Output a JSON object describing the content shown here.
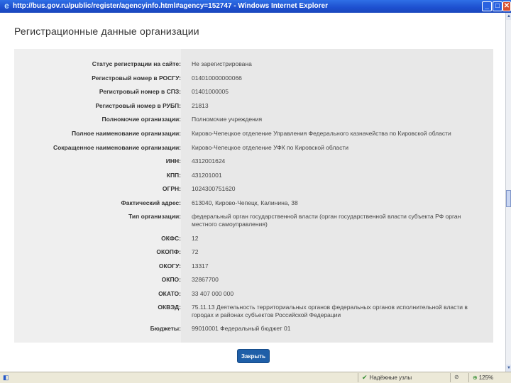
{
  "window": {
    "title": "http://bus.gov.ru/public/register/agencyinfo.html#agency=152747 - Windows Internet Explorer",
    "minimize": "_",
    "maximize": "□",
    "close": "✕"
  },
  "dialog": {
    "title": "Регистрационные данные организации",
    "fields": [
      {
        "label": "Статус регистрации на сайте:",
        "value": "Не зарегистрирована"
      },
      {
        "label": "Регистровый номер в РОСГУ:",
        "value": "014010000000066"
      },
      {
        "label": "Регистровый номер в СПЗ:",
        "value": "01401000005"
      },
      {
        "label": "Регистровый номер в РУБП:",
        "value": "21813"
      },
      {
        "label": "Полномочие организации:",
        "value": "Полномочие учреждения"
      },
      {
        "label": "Полное наименование организации:",
        "value": "Кирово-Чепецкое отделение Управления Федерального казначейства по Кировской области"
      },
      {
        "label": "Сокращенное наименование организации:",
        "value": "Кирово-Чепецкое отделение УФК по Кировской области"
      },
      {
        "label": "ИНН:",
        "value": "4312001624"
      },
      {
        "label": "КПП:",
        "value": "431201001"
      },
      {
        "label": "ОГРН:",
        "value": "1024300751620"
      },
      {
        "label": "Фактический адрес:",
        "value": "613040, Кирово-Чепецк, Калинина, 38"
      },
      {
        "label": "Тип организации:",
        "value": "федеральный орган государственной власти (орган государственной власти субъекта РФ орган местного самоуправления)"
      },
      {
        "label": "ОКФС:",
        "value": "12"
      },
      {
        "label": "ОКОПФ:",
        "value": "72"
      },
      {
        "label": "ОКОГУ:",
        "value": "13317"
      },
      {
        "label": "ОКПО:",
        "value": "32867700"
      },
      {
        "label": "ОКАТО:",
        "value": "33 407 000 000"
      },
      {
        "label": "ОКВЭД:",
        "value": "75.11.13 Деятельность территориальных органов федеральных органов исполнительной власти в городах и районах субъектов Российской Федерации"
      },
      {
        "label": "Бюджеты:",
        "value": "99010001 Федеральный бюджет 01"
      }
    ],
    "close_button": "Закрыть"
  },
  "statusbar": {
    "zone": "Надёжные узлы",
    "zoom": "125%"
  },
  "icons": {
    "ie": "ie-logo-icon",
    "status": "page-icon",
    "zone": "checkmark-icon",
    "lock": "lock-icon",
    "zoom": "zoom-icon"
  }
}
